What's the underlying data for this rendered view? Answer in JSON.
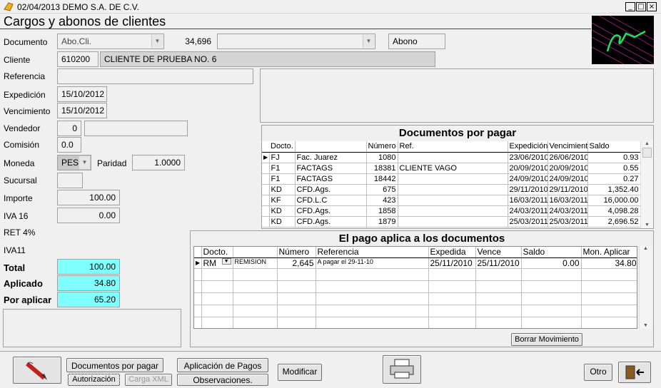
{
  "window": {
    "title": "02/04/2013 DEMO S.A. DE C.V.",
    "buttons": [
      "_",
      "□",
      "×"
    ]
  },
  "heading": "Cargos y abonos de clientes",
  "form": {
    "documento_label": "Documento",
    "documento_value": "Abo.Cli.",
    "documento_num": "34,696",
    "documento_extra": "",
    "documento_tipo": "Abono",
    "cliente_label": "Cliente",
    "cliente_code": "610200",
    "cliente_name": "CLIENTE DE PRUEBA NO. 6",
    "referencia_label": "Referencia",
    "referencia_value": "",
    "expedicion_label": "Expedición",
    "expedicion_value": "15/10/2012",
    "vencimiento_label": "Vencimiento",
    "vencimiento_value": "15/10/2012",
    "vendedor_label": "Vendedor",
    "vendedor_value": "0",
    "vendedor_name": "",
    "comision_label": "Comisión",
    "comision_value": "0.0",
    "moneda_label": "Moneda",
    "moneda_value": "PES",
    "paridad_label": "Paridad",
    "paridad_value": "1.0000",
    "sucursal_label": "Sucursal",
    "sucursal_value": "",
    "importe_label": "Importe",
    "importe_value": "100.00",
    "iva16_label": "IVA 16",
    "iva16_value": "0.00",
    "ret4_label": "RET 4%",
    "iva11_label": "IVA11",
    "total_label": "Total",
    "total_value": "100.00",
    "aplicado_label": "Aplicado",
    "aplicado_value": "34.80",
    "poraplicar_label": "Por aplicar",
    "poraplicar_value": "65.20"
  },
  "docs_por_pagar": {
    "title": "Documentos por pagar",
    "columns": [
      "Docto.",
      "",
      "Número",
      "Ref.",
      "Expedición",
      "Vencimiento",
      "Saldo"
    ],
    "rows": [
      [
        "FJ",
        "Fac. Juarez",
        "1080",
        "",
        "23/06/2010",
        "26/06/2010",
        "0.93"
      ],
      [
        "F1",
        "FACTAGS",
        "18381",
        "CLIENTE VAGO",
        "20/09/2010",
        "20/09/2010",
        "0.55"
      ],
      [
        "F1",
        "FACTAGS",
        "18442",
        "",
        "24/09/2010",
        "24/09/2010",
        "0.27"
      ],
      [
        "KD",
        "CFD.Ags.",
        "675",
        "",
        "29/11/2010",
        "29/11/2010",
        "1,352.40"
      ],
      [
        "KF",
        "CFD.L.C",
        "423",
        "",
        "16/03/2011",
        "16/03/2011",
        "16,000.00"
      ],
      [
        "KD",
        "CFD.Ags.",
        "1858",
        "",
        "24/03/2011",
        "24/03/2011",
        "4,098.28"
      ],
      [
        "KD",
        "CFD.Ags.",
        "1879",
        "",
        "25/03/2011",
        "25/03/2011",
        "2,696.52"
      ]
    ]
  },
  "pago_aplica": {
    "title": "El pago aplica a los documentos",
    "columns": [
      "Docto.",
      "",
      "Número",
      "Referencia",
      "Expedida",
      "Vence",
      "Saldo",
      "Mon. Aplicar"
    ],
    "rows": [
      [
        "RM",
        "REMISION",
        "2,645",
        "A pagar el 29-11-10",
        "25/11/2010",
        "25/11/2010",
        "0.00",
        "34.80"
      ]
    ],
    "borrar_label": "Borrar Movimiento"
  },
  "toolbar": {
    "docs_por_pagar": "Documentos por pagar",
    "autorizacion": "Autorización",
    "carga_xml": "Carga XML",
    "aplicacion_pagos": "Aplicación de Pagos",
    "observaciones": "Observaciones.",
    "modificar": "Modificar",
    "otro": "Otro"
  },
  "icons": [
    "app-icon",
    "pencil-icon",
    "printer-icon",
    "exit-door-icon",
    "company-logo"
  ]
}
